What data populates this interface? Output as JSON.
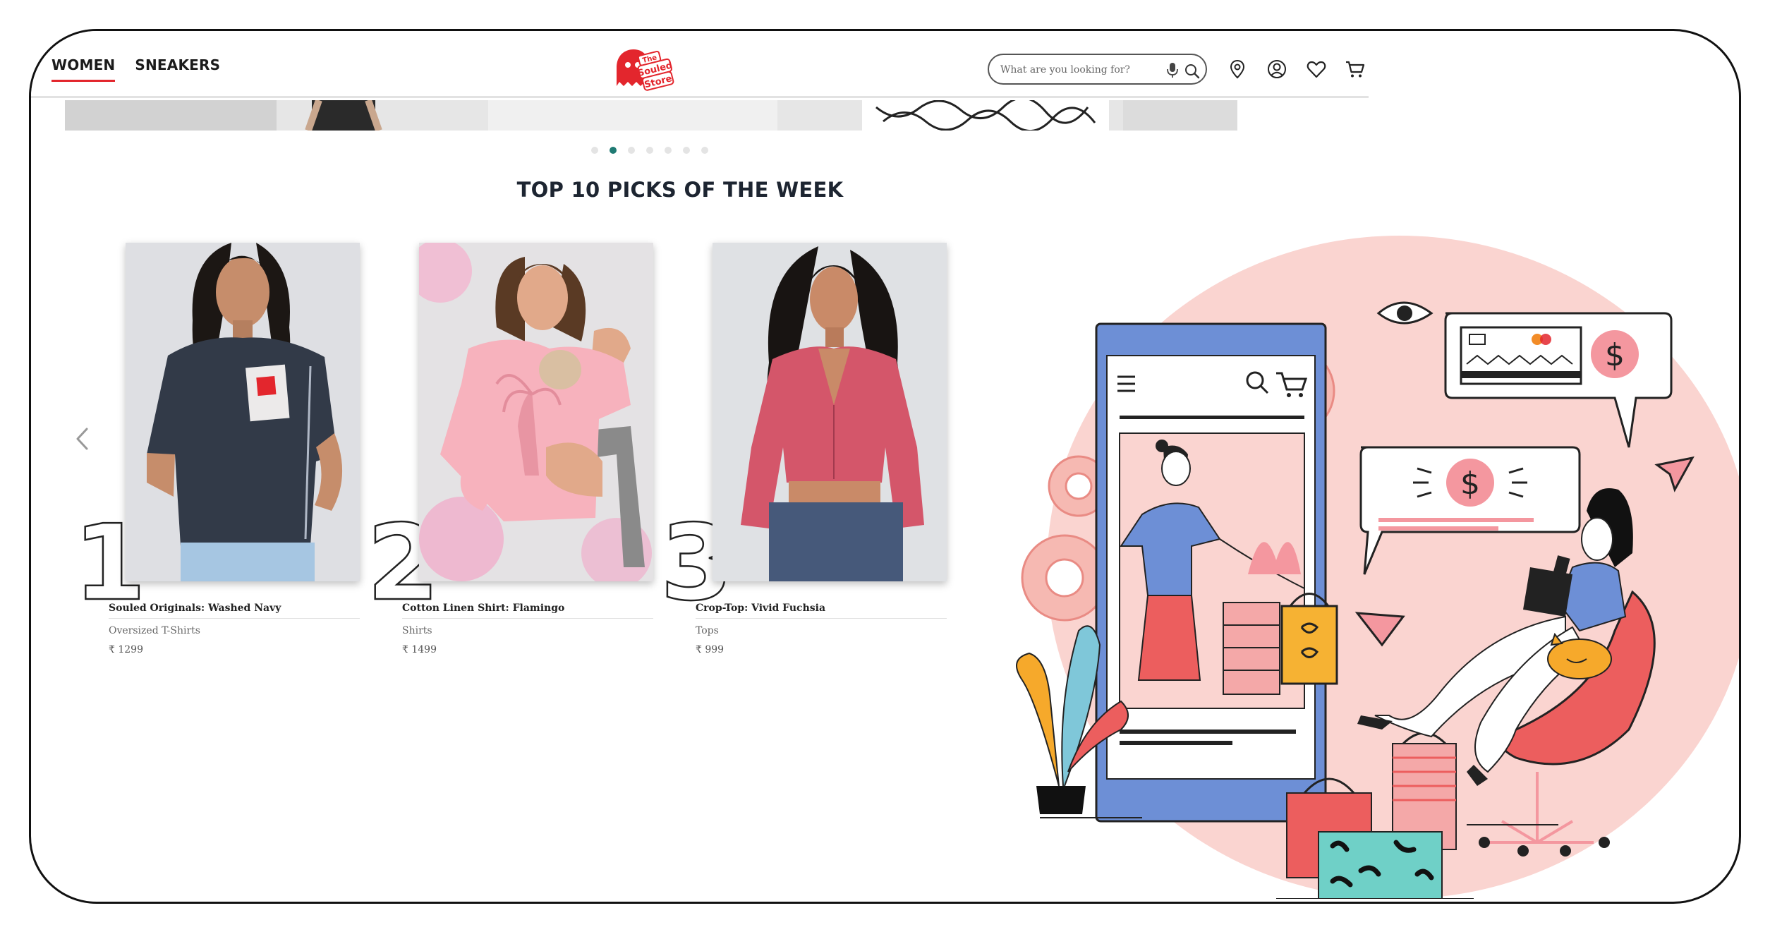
{
  "header": {
    "nav": [
      {
        "label": "WOMEN",
        "active": true
      },
      {
        "label": "SNEAKERS",
        "active": false
      }
    ],
    "logo_text": [
      "The",
      "Souled",
      "Store"
    ],
    "search": {
      "placeholder": "What are you looking for?"
    },
    "icons": [
      "location-icon",
      "account-icon",
      "wishlist-icon",
      "cart-icon"
    ]
  },
  "carousel": {
    "dots": 7,
    "active_dot": 2
  },
  "section": {
    "title": "TOP 10 PICKS OF THE WEEK"
  },
  "products": [
    {
      "rank": "1",
      "name": "Souled Originals: Washed Navy",
      "category": "Oversized T-Shirts",
      "price": "₹ 1299"
    },
    {
      "rank": "2",
      "name": "Cotton Linen Shirt: Flamingo",
      "category": "Shirts",
      "price": "₹ 1499"
    },
    {
      "rank": "3",
      "name": "Crop-Top: Vivid Fuchsia",
      "category": "Tops",
      "price": "₹ 999"
    }
  ],
  "colors": {
    "accent_red": "#e3262d",
    "active_dot": "#1f7a73",
    "title_navy": "#1d2531",
    "illustration_pink": "#fad4d0",
    "phone_blue": "#6d8fd6"
  }
}
